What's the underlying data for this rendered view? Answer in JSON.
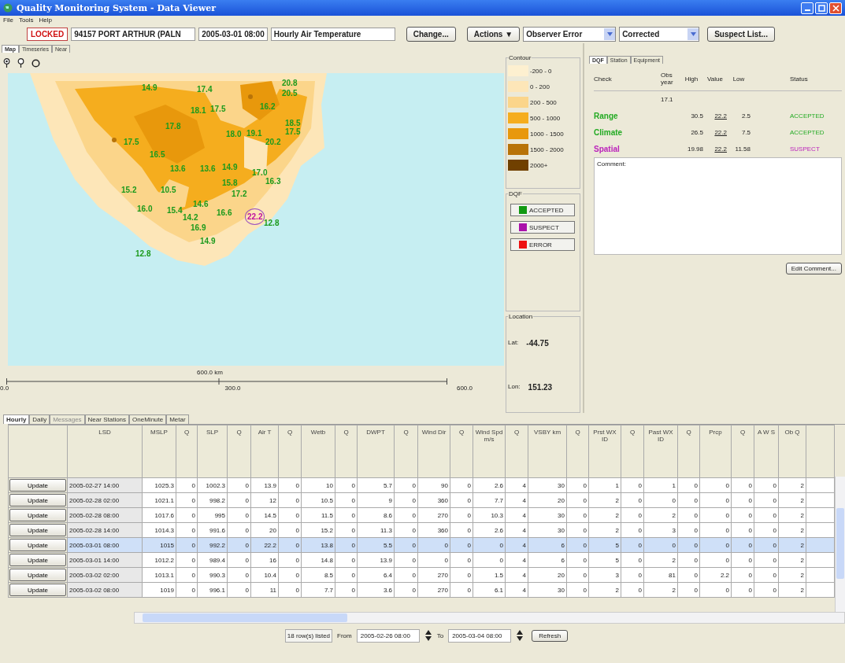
{
  "window": {
    "title": "Quality Monitoring System - Data Viewer"
  },
  "menu": [
    "File",
    "Tools",
    "Help"
  ],
  "toolbar": {
    "lock": "LOCKED",
    "station": "94157  PORT ARTHUR (PALN",
    "time": "2005-03-01 08:00",
    "element": "Hourly Air Temperature",
    "change": "Change...",
    "actions": "Actions ▼",
    "reason": "Observer Error",
    "correction": "Corrected",
    "suspect_list": "Suspect List..."
  },
  "left_tabs": [
    {
      "label": "Map",
      "selected": true
    },
    {
      "label": "Timeseries",
      "selected": false
    },
    {
      "label": "Near",
      "selected": false
    }
  ],
  "map": {
    "labels": [
      {
        "value": "14.9",
        "kind": "accepted",
        "color": "#1c9a1c"
      },
      {
        "value": "17.4",
        "kind": "accepted",
        "color": "#1c9a1c"
      },
      {
        "value": "20.8",
        "kind": "accepted",
        "color": "#1c9a1c"
      },
      {
        "value": "20.5",
        "kind": "accepted",
        "color": "#1c9a1c"
      },
      {
        "value": "18.1",
        "kind": "accepted",
        "color": "#1c9a1c"
      },
      {
        "value": "17.5",
        "kind": "accepted",
        "color": "#1c9a1c"
      },
      {
        "value": "16.2",
        "kind": "accepted",
        "color": "#1c9a1c"
      },
      {
        "value": "18.5",
        "kind": "accepted",
        "color": "#1c9a1c"
      },
      {
        "value": "17.8",
        "kind": "accepted",
        "color": "#1c9a1c"
      },
      {
        "value": "18.0",
        "kind": "accepted",
        "color": "#1c9a1c"
      },
      {
        "value": "19.1",
        "kind": "accepted",
        "color": "#1c9a1c"
      },
      {
        "value": "17.5",
        "kind": "accepted",
        "color": "#1c9a1c"
      },
      {
        "value": "20.2",
        "kind": "accepted",
        "color": "#1c9a1c"
      },
      {
        "value": "17.5",
        "kind": "accepted",
        "color": "#1c9a1c"
      },
      {
        "value": "16.5",
        "kind": "accepted",
        "color": "#1c9a1c"
      },
      {
        "value": "13.6",
        "kind": "accepted",
        "color": "#1c9a1c"
      },
      {
        "value": "13.6",
        "kind": "accepted",
        "color": "#1c9a1c"
      },
      {
        "value": "14.9",
        "kind": "accepted",
        "color": "#1c9a1c"
      },
      {
        "value": "17.0",
        "kind": "accepted",
        "color": "#1c9a1c"
      },
      {
        "value": "16.3",
        "kind": "accepted",
        "color": "#1c9a1c"
      },
      {
        "value": "15.2",
        "kind": "accepted",
        "color": "#1c9a1c"
      },
      {
        "value": "10.5",
        "kind": "accepted",
        "color": "#1c9a1c"
      },
      {
        "value": "15.8",
        "kind": "accepted",
        "color": "#1c9a1c"
      },
      {
        "value": "17.2",
        "kind": "accepted",
        "color": "#1c9a1c"
      },
      {
        "value": "16.0",
        "kind": "accepted",
        "color": "#1c9a1c"
      },
      {
        "value": "15.4",
        "kind": "accepted",
        "color": "#1c9a1c"
      },
      {
        "value": "14.6",
        "kind": "accepted",
        "color": "#1c9a1c"
      },
      {
        "value": "16.6",
        "kind": "accepted",
        "color": "#1c9a1c"
      },
      {
        "value": "22.2",
        "kind": "suspect",
        "color": "#c010a0"
      },
      {
        "value": "12.8",
        "kind": "accepted",
        "color": "#1c9a1c"
      },
      {
        "value": "14.2",
        "kind": "accepted",
        "color": "#1c9a1c"
      },
      {
        "value": "16.9",
        "kind": "accepted",
        "color": "#1c9a1c"
      },
      {
        "value": "14.9",
        "kind": "accepted",
        "color": "#1c9a1c"
      },
      {
        "value": "12.8",
        "kind": "accepted",
        "color": "#1c9a1c"
      }
    ],
    "scale": "600.0 km",
    "axis": [
      "0.0",
      "300.0",
      "600.0"
    ]
  },
  "contour": {
    "title": "Contour",
    "items": [
      {
        "label": "-200 - 0",
        "color": "#fdf0d0"
      },
      {
        "label": "0 - 200",
        "color": "#fde6b8"
      },
      {
        "label": "200 - 500",
        "color": "#fbd58a"
      },
      {
        "label": "500 - 1000",
        "color": "#f5ad1e"
      },
      {
        "label": "1000 - 1500",
        "color": "#e8980c"
      },
      {
        "label": "1500 - 2000",
        "color": "#b87308"
      },
      {
        "label": "2000+",
        "color": "#704000"
      }
    ]
  },
  "dqf_legend": {
    "title": "DQF",
    "items": [
      {
        "label": "ACCEPTED",
        "color": "#119911"
      },
      {
        "label": "SUSPECT",
        "color": "#aa11aa"
      },
      {
        "label": "ERROR",
        "color": "#ee1111"
      }
    ]
  },
  "location": {
    "title": "Location",
    "lat_label": "Lat:",
    "lat": "-44.75",
    "lon_label": "Lon:",
    "lon": "151.23"
  },
  "right_tabs": [
    {
      "label": "DQF",
      "selected": true
    },
    {
      "label": "Station",
      "selected": false
    },
    {
      "label": "Equipment",
      "selected": false
    }
  ],
  "checks": {
    "columns": [
      "Check",
      "Obs year",
      "High",
      "Value",
      "Low",
      "Status"
    ],
    "obs_year": "17.1",
    "rows": [
      {
        "check": "Range",
        "high": "30.5",
        "value": "22.2",
        "low": "2.5",
        "status": "ACCEPTED",
        "color": "#22aa22"
      },
      {
        "check": "Climate",
        "high": "26.5",
        "value": "22.2",
        "low": "7.5",
        "status": "ACCEPTED",
        "color": "#22aa22"
      },
      {
        "check": "Spatial",
        "high": "19.98",
        "value": "22.2",
        "low": "11.58",
        "status": "SUSPECT",
        "color": "#bb22bb"
      }
    ]
  },
  "comment": {
    "label": "Comment:",
    "button": "Edit Comment..."
  },
  "bottom_tabs": [
    {
      "label": "Hourly",
      "selected": true,
      "disabled": false
    },
    {
      "label": "Daily",
      "selected": false,
      "disabled": false
    },
    {
      "label": "Messages",
      "selected": false,
      "disabled": true
    },
    {
      "label": "Near Stations",
      "selected": false,
      "disabled": false
    },
    {
      "label": "OneMinute",
      "selected": false,
      "disabled": false
    },
    {
      "label": "Metar",
      "selected": false,
      "disabled": false
    }
  ],
  "table": {
    "columns": [
      "LSD",
      "MSLP",
      "Q",
      "SLP",
      "Q",
      "Air T",
      "Q",
      "Wetb",
      "Q",
      "DWPT",
      "Q",
      "Wind Dir",
      "Q",
      "Wind Spd m/s",
      "Q",
      "VSBY km",
      "Q",
      "Prst WX ID",
      "Q",
      "Past WX ID",
      "Q",
      "Prcp",
      "Q",
      "A W S",
      "Ob Q"
    ],
    "rows": [
      {
        "button": "Update",
        "selected": false,
        "cells": [
          "2005-02-27 14:00",
          "1025.3",
          "0",
          "1002.3",
          "0",
          "13.9",
          "0",
          "10",
          "0",
          "5.7",
          "0",
          "90",
          "0",
          "2.6",
          "4",
          "30",
          "0",
          "1",
          "0",
          "1",
          "0",
          "0",
          "0",
          "0",
          "2"
        ]
      },
      {
        "button": "Update",
        "selected": false,
        "cells": [
          "2005-02-28 02:00",
          "1021.1",
          "0",
          "998.2",
          "0",
          "12",
          "0",
          "10.5",
          "0",
          "9",
          "0",
          "360",
          "0",
          "7.7",
          "4",
          "20",
          "0",
          "2",
          "0",
          "0",
          "0",
          "0",
          "0",
          "0",
          "2"
        ]
      },
      {
        "button": "Update",
        "selected": false,
        "cells": [
          "2005-02-28 08:00",
          "1017.6",
          "0",
          "995",
          "0",
          "14.5",
          "0",
          "11.5",
          "0",
          "8.6",
          "0",
          "270",
          "0",
          "10.3",
          "4",
          "30",
          "0",
          "2",
          "0",
          "2",
          "0",
          "0",
          "0",
          "0",
          "2"
        ]
      },
      {
        "button": "Update",
        "selected": false,
        "cells": [
          "2005-02-28 14:00",
          "1014.3",
          "0",
          "991.6",
          "0",
          "20",
          "0",
          "15.2",
          "0",
          "11.3",
          "0",
          "360",
          "0",
          "2.6",
          "4",
          "30",
          "0",
          "2",
          "0",
          "3",
          "0",
          "0",
          "0",
          "0",
          "2"
        ]
      },
      {
        "button": "Update",
        "selected": true,
        "cells": [
          "2005-03-01 08:00",
          "1015",
          "0",
          "992.2",
          "0",
          "22.2",
          "0",
          "13.8",
          "0",
          "5.5",
          "0",
          "0",
          "0",
          "0",
          "4",
          "6",
          "0",
          "5",
          "0",
          "0",
          "0",
          "0",
          "0",
          "0",
          "2"
        ]
      },
      {
        "button": "Update",
        "selected": false,
        "cells": [
          "2005-03-01 14:00",
          "1012.2",
          "0",
          "989.4",
          "0",
          "16",
          "0",
          "14.8",
          "0",
          "13.9",
          "0",
          "0",
          "0",
          "0",
          "4",
          "6",
          "0",
          "5",
          "0",
          "2",
          "0",
          "0",
          "0",
          "0",
          "2"
        ]
      },
      {
        "button": "Update",
        "selected": false,
        "cells": [
          "2005-03-02 02:00",
          "1013.1",
          "0",
          "990.3",
          "0",
          "10.4",
          "0",
          "8.5",
          "0",
          "6.4",
          "0",
          "270",
          "0",
          "1.5",
          "4",
          "20",
          "0",
          "3",
          "0",
          "81",
          "0",
          "2.2",
          "0",
          "0",
          "2"
        ]
      },
      {
        "button": "Update",
        "selected": false,
        "cells": [
          "2005-03-02 08:00",
          "1019",
          "0",
          "996.1",
          "0",
          "11",
          "0",
          "7.7",
          "0",
          "3.6",
          "0",
          "270",
          "0",
          "6.1",
          "4",
          "30",
          "0",
          "2",
          "0",
          "2",
          "0",
          "0",
          "0",
          "0",
          "2"
        ]
      }
    ]
  },
  "footer": {
    "count": "18 row(s) listed",
    "from_label": "From",
    "from": "2005-02-26 08:00",
    "to_label": "To",
    "to": "2005-03-04 08:00",
    "refresh": "Refresh"
  }
}
